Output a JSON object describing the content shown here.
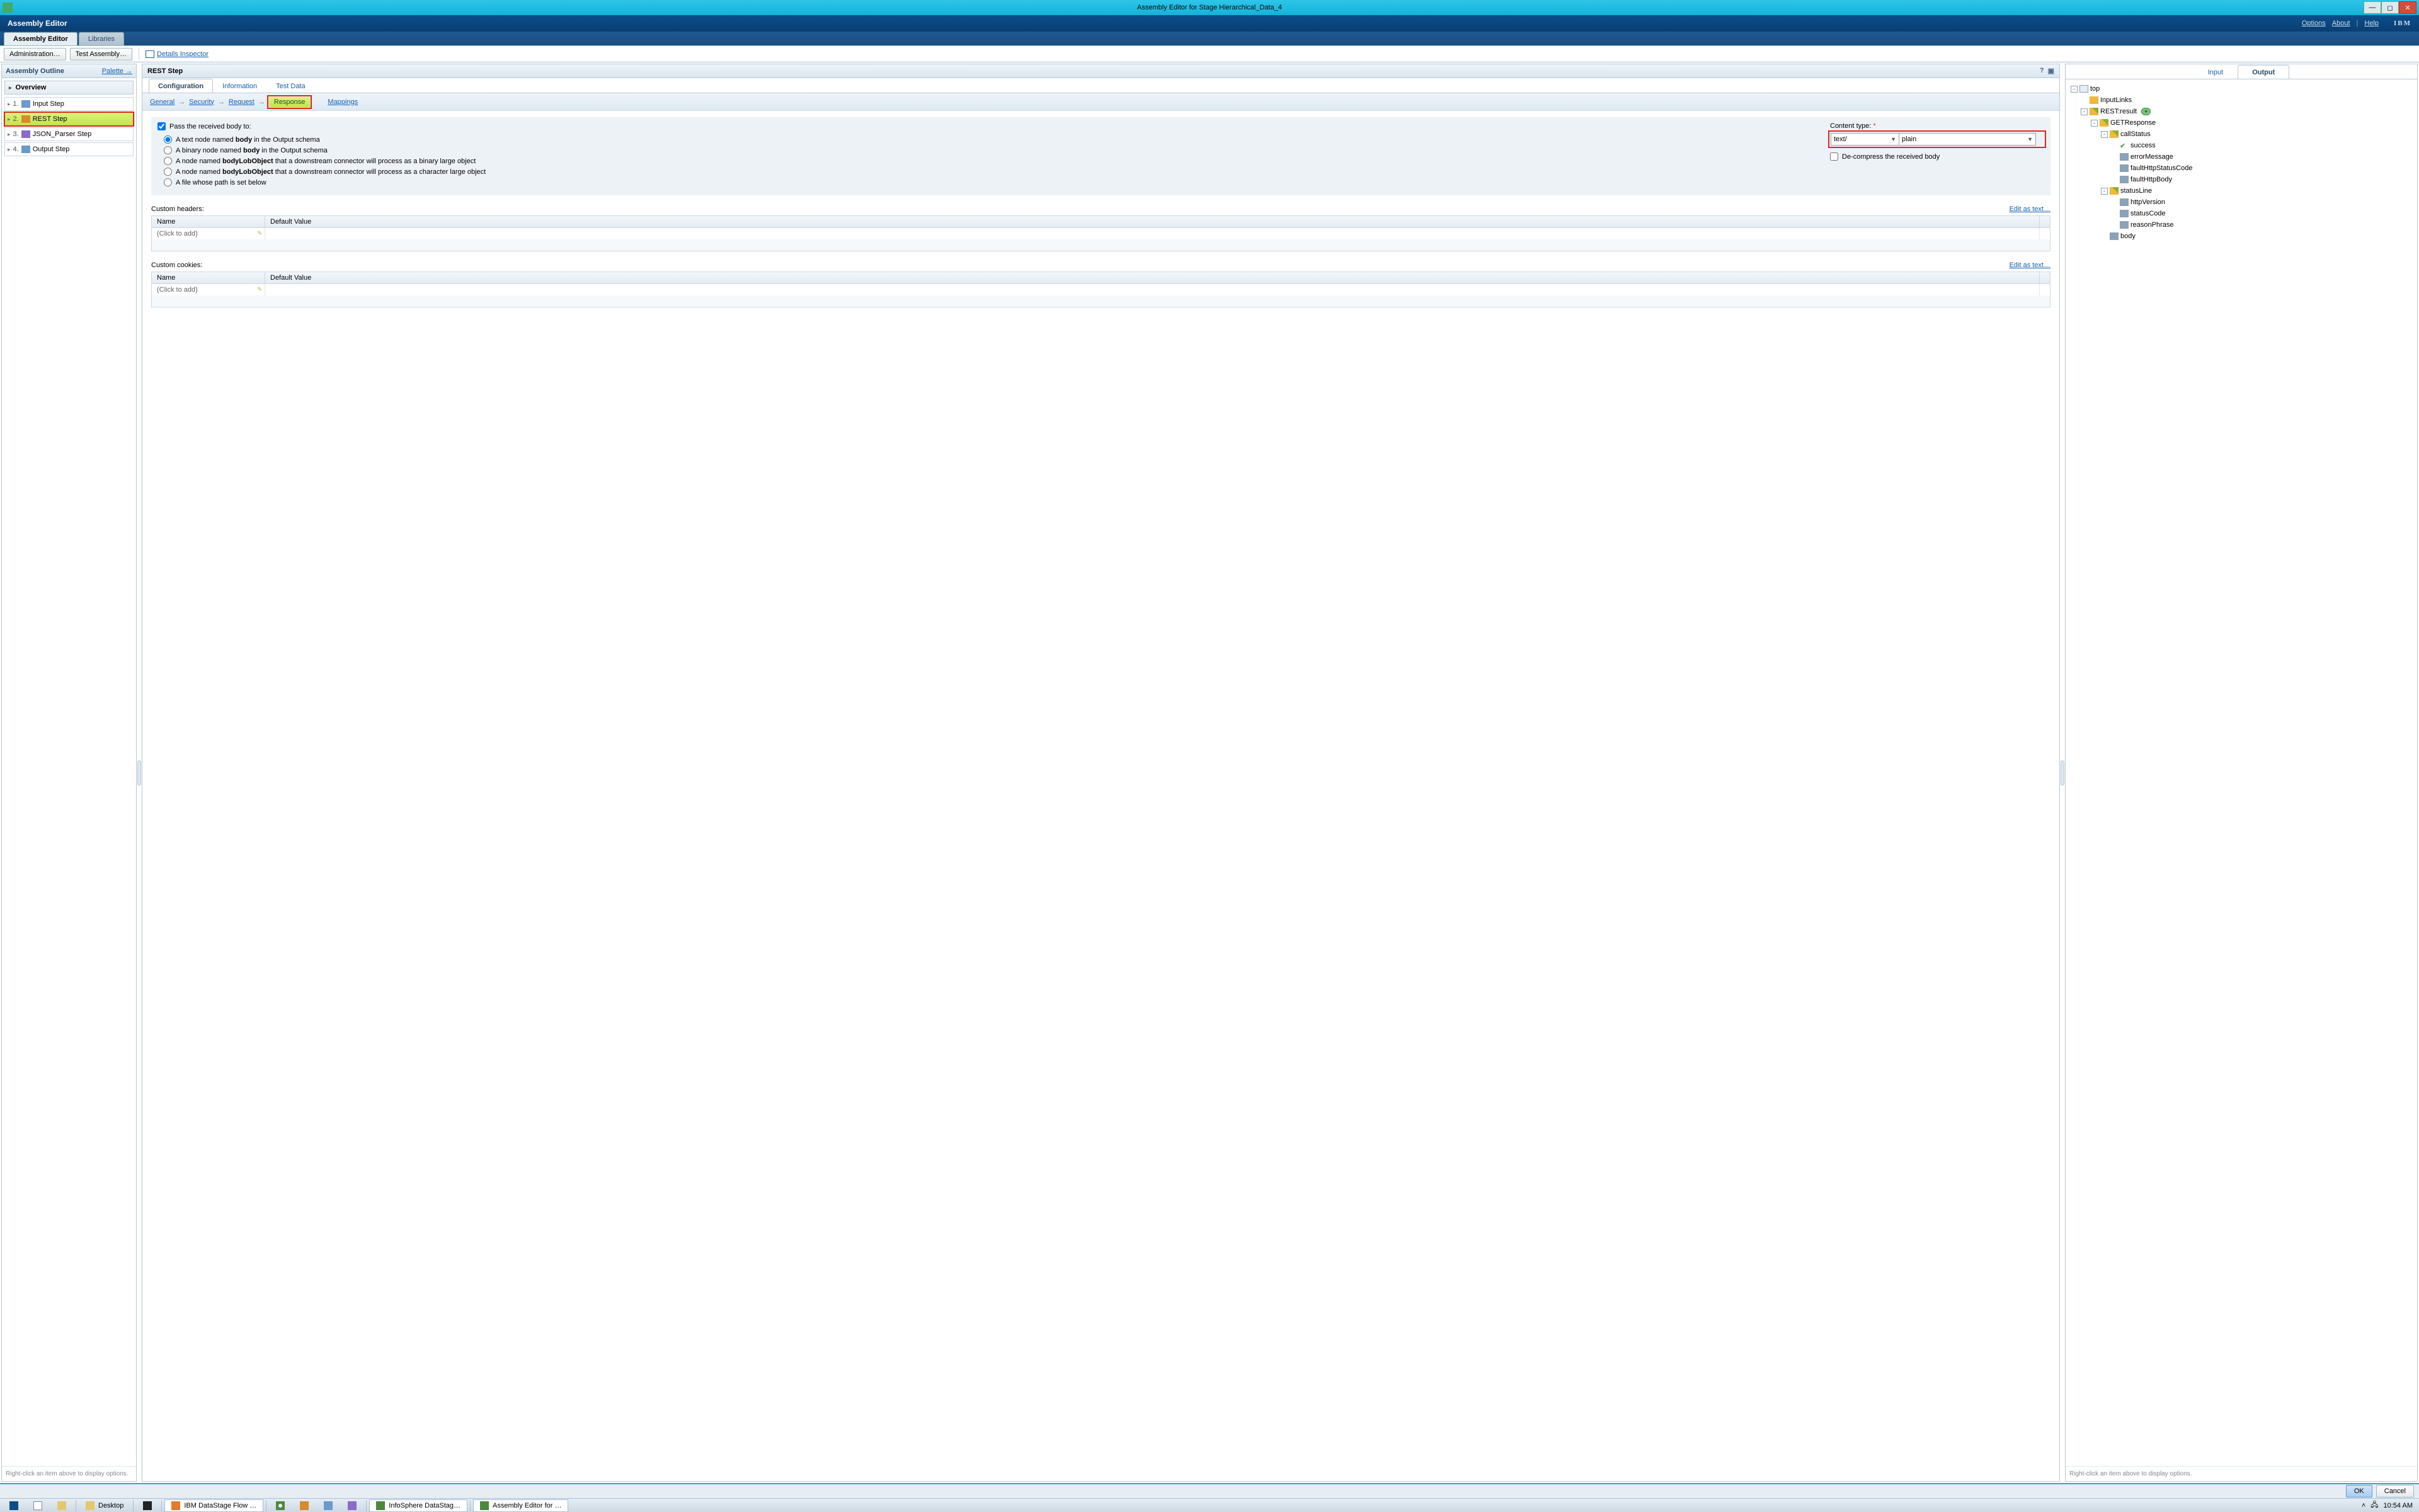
{
  "window": {
    "title": "Assembly Editor for Stage Hierarchical_Data_4"
  },
  "banner": {
    "title": "Assembly Editor",
    "links": {
      "options": "Options",
      "about": "About",
      "help": "Help"
    },
    "logo": "IBM"
  },
  "main_tabs": [
    "Assembly Editor",
    "Libraries"
  ],
  "toolbar": {
    "admin": "Administration…",
    "test": "Test Assembly…",
    "details_inspector": "Details Inspector"
  },
  "outline": {
    "head": "Assembly Outline",
    "palette": "Palette",
    "overview": "Overview",
    "steps": [
      {
        "num": "1.",
        "label": "Input Step"
      },
      {
        "num": "2.",
        "label": "REST Step"
      },
      {
        "num": "3.",
        "label": "JSON_Parser Step"
      },
      {
        "num": "4.",
        "label": "Output Step"
      }
    ],
    "foot": "Right-click an item above to display options."
  },
  "center": {
    "head": "REST Step",
    "sub_tabs": [
      "Configuration",
      "Information",
      "Test Data"
    ],
    "crumbs": [
      "General",
      "Security",
      "Request",
      "Response",
      "Mappings"
    ],
    "form": {
      "pass_label": "Pass the received body to:",
      "radios": {
        "text_node_pre": "A text node named ",
        "text_node_bold": "body",
        "text_node_post": " in the Output schema",
        "binary_node_pre": "A binary node named ",
        "binary_node_bold": "body",
        "binary_node_post": " in the Output schema",
        "lob_bin_pre": "A node named ",
        "lob_bin_bold": "bodyLobObject",
        "lob_bin_post": " that a downstream connector will process as a binary large object",
        "lob_char_pre": "A node named ",
        "lob_char_bold": "bodyLobObject",
        "lob_char_post": " that a downstream connector will process as a character large object",
        "file_path": "A file whose path is set below"
      },
      "content_type_label": "Content type:",
      "content_type_value": "text/",
      "content_subtype_value": "plain",
      "decompress_label": "De-compress the received body"
    },
    "headers": {
      "title": "Custom headers:",
      "edit": "Edit as text…",
      "cols": [
        "Name",
        "Default Value"
      ],
      "placeholder": "(Click to add)"
    },
    "cookies": {
      "title": "Custom cookies:",
      "edit": "Edit as text…",
      "cols": [
        "Name",
        "Default Value"
      ],
      "placeholder": "(Click to add)"
    }
  },
  "right": {
    "tabs": [
      "Input",
      "Output"
    ],
    "tree": [
      {
        "depth": 0,
        "toggle": "-",
        "icon": "folder",
        "label": "top"
      },
      {
        "depth": 1,
        "toggle": "",
        "icon": "group",
        "label": "InputLinks"
      },
      {
        "depth": 1,
        "toggle": "-",
        "icon": "group-dec",
        "label": "REST:result",
        "badge": true
      },
      {
        "depth": 2,
        "toggle": "-",
        "icon": "group-dec",
        "label": "GETResponse"
      },
      {
        "depth": 3,
        "toggle": "-",
        "icon": "group-dec",
        "label": "callStatus"
      },
      {
        "depth": 4,
        "toggle": "",
        "icon": "success",
        "label": "success"
      },
      {
        "depth": 4,
        "toggle": "",
        "icon": "leaf",
        "label": "errorMessage"
      },
      {
        "depth": 4,
        "toggle": "",
        "icon": "leaf",
        "label": "faultHttpStatusCode"
      },
      {
        "depth": 4,
        "toggle": "",
        "icon": "leaf",
        "label": "faultHttpBody"
      },
      {
        "depth": 3,
        "toggle": "-",
        "icon": "group-dec",
        "label": "statusLine"
      },
      {
        "depth": 4,
        "toggle": "",
        "icon": "leaf",
        "label": "httpVersion"
      },
      {
        "depth": 4,
        "toggle": "",
        "icon": "leaf",
        "label": "statusCode"
      },
      {
        "depth": 4,
        "toggle": "",
        "icon": "leaf",
        "label": "reasonPhrase"
      },
      {
        "depth": 3,
        "toggle": "",
        "icon": "leaf",
        "label": "body"
      }
    ],
    "foot": "Right-click an item above to display options."
  },
  "footer": {
    "ok": "OK",
    "cancel": "Cancel"
  },
  "taskbar": {
    "items": [
      {
        "label": "",
        "icon_only": true
      },
      {
        "label": "",
        "icon_only": true
      },
      {
        "label": "",
        "icon_only": true
      },
      {
        "label": "Desktop"
      },
      {
        "label": "",
        "icon_only": true
      },
      {
        "label": "IBM DataStage Flow …"
      },
      {
        "label": "",
        "icon_only": true
      },
      {
        "label": "",
        "icon_only": true
      },
      {
        "label": "",
        "icon_only": true
      },
      {
        "label": "",
        "icon_only": true
      },
      {
        "label": "InfoSphere DataStag…"
      },
      {
        "label": "Assembly Editor for …"
      }
    ],
    "time": "10:54 AM"
  }
}
